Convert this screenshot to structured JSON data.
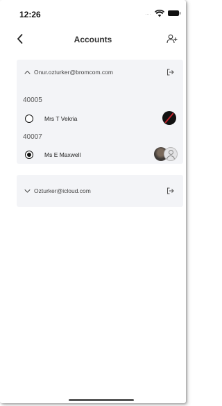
{
  "status_bar": {
    "time": "12:26",
    "signal": "....",
    "icons": [
      "wifi-icon",
      "battery-icon"
    ]
  },
  "nav": {
    "title": "Accounts",
    "back_icon": "chevron-left-icon",
    "action_icon": "add-user-icon"
  },
  "accounts": [
    {
      "email": "Onur.ozturker@bromcom.com",
      "expanded": true,
      "chevron_icon": "chevron-up-icon",
      "logout_icon": "logout-icon",
      "groups": [
        {
          "id": "40005",
          "students": [
            {
              "name": "Mrs T Vekria",
              "selected": false,
              "avatar_icon": "red-stroke-avatar-icon"
            }
          ]
        },
        {
          "id": "40007",
          "students": [
            {
              "name": "Ms E Maxwell",
              "selected": true,
              "avatar_icon": "photo-and-placeholder-avatar-icon"
            }
          ]
        }
      ]
    },
    {
      "email": "Ozturker@icloud.com",
      "expanded": false,
      "chevron_icon": "chevron-down-icon",
      "logout_icon": "logout-icon",
      "groups": []
    }
  ],
  "colors": {
    "card_background": "#f3f4f7",
    "text_primary": "#222222",
    "avatar_accent": "#c0232c"
  }
}
